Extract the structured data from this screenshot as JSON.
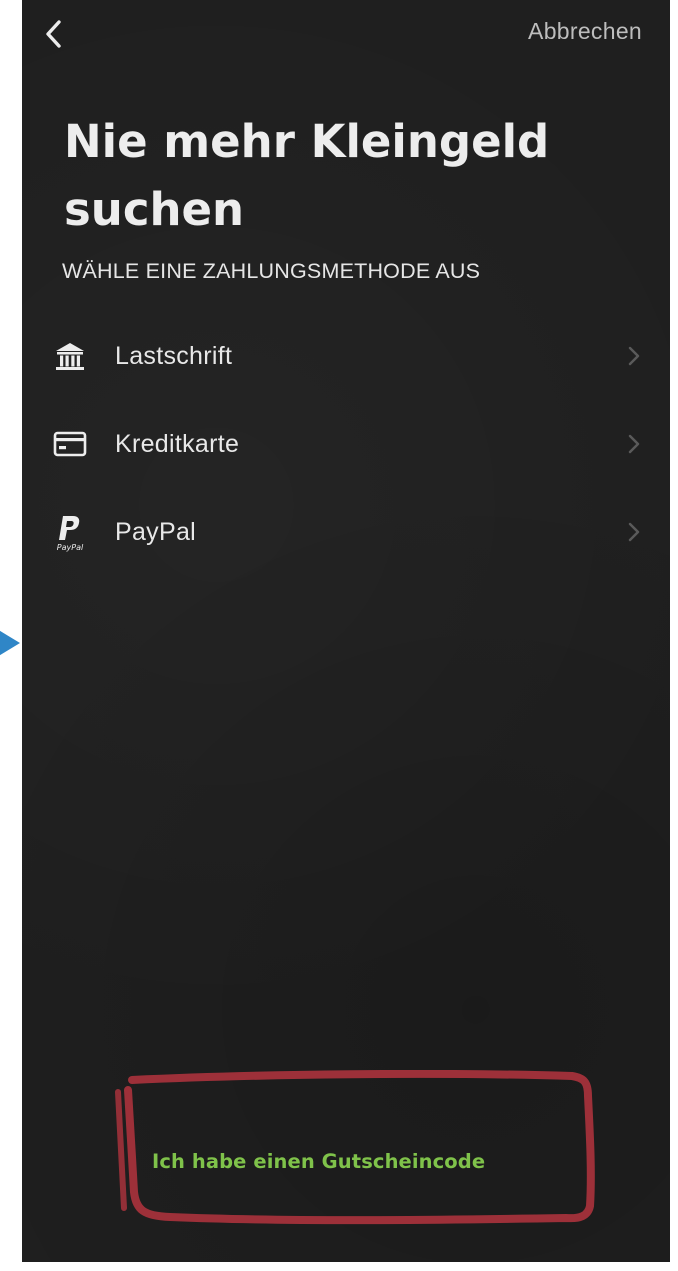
{
  "nav": {
    "back_icon": "chevron-left-icon",
    "cancel_label": "Abbrechen"
  },
  "heading": {
    "title": "Nie mehr Kleingeld suchen",
    "subtitle": "WÄHLE EINE ZAHLUNGSMETHODE AUS"
  },
  "payment_methods": [
    {
      "label": "Lastschrift",
      "icon": "bank-icon"
    },
    {
      "label": "Kreditkarte",
      "icon": "credit-card-icon"
    },
    {
      "label": "PayPal",
      "icon": "paypal-icon",
      "icon_text": "PayPal"
    }
  ],
  "voucher": {
    "label": "Ich habe einen Gutscheincode"
  },
  "colors": {
    "background": "#1f1f1f",
    "text": "#e8e8e8",
    "muted": "#bdbdbd",
    "accent": "#7fc24a",
    "annotation": "#a8323c",
    "side_arrow": "#2f86c7"
  }
}
